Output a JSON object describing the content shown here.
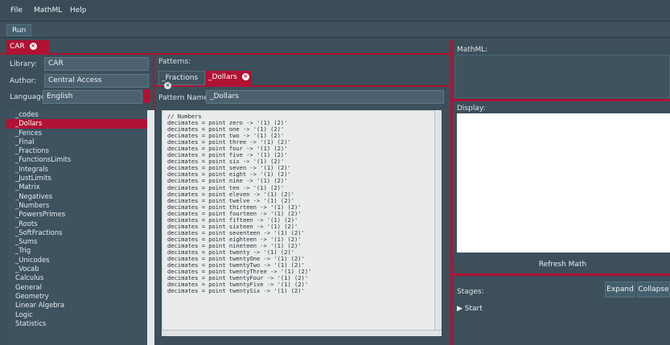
{
  "menubar": {
    "file": "File",
    "mathml": "MathML",
    "help": "Help"
  },
  "toolbar": {
    "run": "Run"
  },
  "document_tab": {
    "label": "CAR",
    "close": "×"
  },
  "left": {
    "library_label": "Library:",
    "library_value": "CAR",
    "author_label": "Author:",
    "author_value": "Central Access",
    "language_label": "Language:",
    "language_value": "English",
    "items": [
      "_codes",
      "_Dollars",
      "_Fences",
      "_Final",
      "_Fractions",
      "_FunctionsLimits",
      "_Integrals",
      "_JustLimits",
      "_Matrix",
      "_Negatives",
      "_Numbers",
      "_PowersPrimes",
      "_Roots",
      "_SoftFractions",
      "_Sums",
      "_Trig",
      "_Unicodes",
      "_Vocab",
      "Calculus",
      "General",
      "Geometry",
      "Linear Algebra",
      "Logic",
      "Statistics"
    ],
    "selected_index": 1
  },
  "center": {
    "patterns_label": "Patterns:",
    "tabs": [
      {
        "label": "_Fractions",
        "close": "×"
      },
      {
        "label": "_Dollars",
        "close": "×"
      }
    ],
    "pattern_name_label": "Pattern Name:",
    "pattern_name_value": "_Dollars",
    "code_lines": [
      "// Numbers",
      "decimates = point zero -> '(1) (2)'",
      "decimates = point one -> '(1) (2)'",
      "decimates = point two -> '(1) (2)'",
      "decimates = point three -> '(1) (2)'",
      "decimates = point four -> '(1) (2)'",
      "decimates = point five -> '(1) (2)'",
      "decimates = point six -> '(1) (2)'",
      "decimates = point seven -> '(1) (2)'",
      "decimates = point eight -> '(1) (2)'",
      "decimates = point nine -> '(1) (2)'",
      "decimates = point ten -> '(1) (2)'",
      "decimates = point eleven -> '(1) (2)'",
      "decimates = point twelve -> '(1) (2)'",
      "decimates = point thirteen -> '(1) (2)'",
      "decimates = point fourteen -> '(1) (2)'",
      "decimates = point fifteen -> '(1) (2)'",
      "decimates = point sixteen -> '(1) (2)'",
      "decimates = point seventeen -> '(1) (2)'",
      "decimates = point eighteen -> '(1) (2)'",
      "decimates = point nineteen -> '(1) (2)'",
      "decimates = point twenty -> '(1) (2)'",
      "decimates = point twentyOne -> '(1) (2)'",
      "decimates = point twentyTwo -> '(1) (2)'",
      "decimates = point twentyThree -> '(1) (2)'",
      "decimates = point twentyFour -> '(1) (2)'",
      "decimates = point twentyFive -> '(1) (2)'",
      "decimates = point twentySix -> '(1) (2)'"
    ]
  },
  "right": {
    "mathml_label": "MathML:",
    "display_label": "Display:",
    "refresh": "Refresh Math",
    "stages_label": "Stages:",
    "expand": "Expand",
    "collapse": "Collapse",
    "start": "Start"
  },
  "colors": {
    "accent": "#b01234",
    "background": "#3c4f5a"
  }
}
